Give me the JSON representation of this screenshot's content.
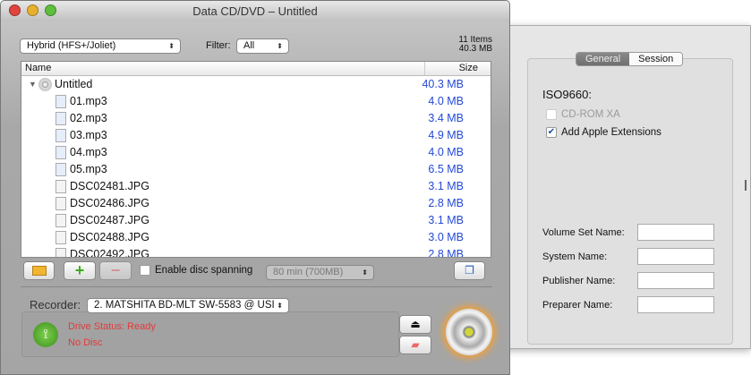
{
  "window": {
    "title": "Data CD/DVD – Untitled"
  },
  "toolbar": {
    "format": "Hybrid (HFS+/Joliet)",
    "filter_label": "Filter:",
    "filter": "All",
    "item_count": "11 Items",
    "total_size": "40.3 MB"
  },
  "list": {
    "col_name": "Name",
    "col_size": "Size",
    "root": {
      "name": "Untitled",
      "size": "40.3 MB"
    },
    "items": [
      {
        "name": "01.mp3",
        "size": "4.0 MB"
      },
      {
        "name": "02.mp3",
        "size": "3.4 MB"
      },
      {
        "name": "03.mp3",
        "size": "4.9 MB"
      },
      {
        "name": "04.mp3",
        "size": "4.0 MB"
      },
      {
        "name": "05.mp3",
        "size": "6.5 MB"
      },
      {
        "name": "DSC02481.JPG",
        "size": "3.1 MB"
      },
      {
        "name": "DSC02486.JPG",
        "size": "2.8 MB"
      },
      {
        "name": "DSC02487.JPG",
        "size": "3.1 MB"
      },
      {
        "name": "DSC02488.JPG",
        "size": "3.0 MB"
      },
      {
        "name": "DSC02492.JPG",
        "size": "2.8 MB"
      }
    ]
  },
  "bottom": {
    "spanning_label": "Enable disc spanning",
    "spanning_size": "80 min (700MB)"
  },
  "recorder": {
    "label": "Recorder:",
    "device": "2. MATSHITA BD-MLT SW-5583 @ USI",
    "status": "Drive Status: Ready",
    "disc": "No Disc"
  },
  "drawer": {
    "tabs": [
      "General",
      "Session"
    ],
    "heading": "ISO9660:",
    "cdrom_xa": "CD-ROM XA",
    "apple_ext": "Add Apple Extensions",
    "fields": [
      "Volume Set Name:",
      "System Name:",
      "Publisher Name:",
      "Preparer Name:"
    ]
  }
}
